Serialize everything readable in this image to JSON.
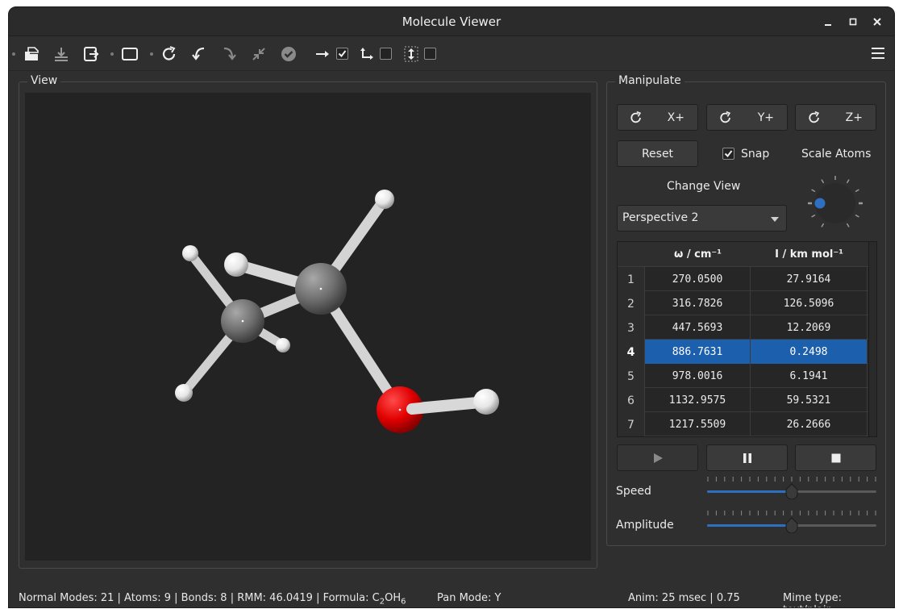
{
  "window": {
    "title": "Molecule Viewer"
  },
  "view": {
    "label": "View"
  },
  "manipulate": {
    "label": "Manipulate",
    "rotate_x": "X+",
    "rotate_y": "Y+",
    "rotate_z": "Z+",
    "reset": "Reset",
    "snap_label": "Snap",
    "snap_checked": true,
    "scale_atoms": "Scale Atoms",
    "change_view": "Change View",
    "view_selected": "Perspective 2",
    "speed_label": "Speed",
    "speed_value": 0.5,
    "amplitude_label": "Amplitude",
    "amplitude_value": 0.5
  },
  "table": {
    "col_omega": "ω / cm⁻¹",
    "col_intensity": "I / km mol⁻¹",
    "rows": [
      {
        "n": "1",
        "omega": "270.0500",
        "intensity": "27.9164"
      },
      {
        "n": "2",
        "omega": "316.7826",
        "intensity": "126.5096"
      },
      {
        "n": "3",
        "omega": "447.5693",
        "intensity": "12.2069"
      },
      {
        "n": "4",
        "omega": "886.7631",
        "intensity": "0.2498"
      },
      {
        "n": "5",
        "omega": "978.0016",
        "intensity": "6.1941"
      },
      {
        "n": "6",
        "omega": "1132.9575",
        "intensity": "59.5321"
      },
      {
        "n": "7",
        "omega": "1217.5509",
        "intensity": "26.2666"
      }
    ],
    "selected_row": "4"
  },
  "toolbar": {
    "check_arrow": true,
    "check_axes": false,
    "check_updown": false
  },
  "status": {
    "info_prefix": "Normal Modes: 21 | Atoms: 9 | Bonds: 8 | RMM: 46.0419 | Formula: C",
    "formula_sub1": "2",
    "formula_mid": "OH",
    "formula_sub2": "6",
    "pan_mode": "Pan Mode: Y",
    "anim": "Anim: 25 msec | 0.75",
    "mime": "Mime type: text/plain"
  },
  "colors": {
    "accent": "#1b5fad",
    "oxygen": "#e00000",
    "carbon": "#7a7a7a",
    "hydrogen": "#f0f0f0"
  }
}
